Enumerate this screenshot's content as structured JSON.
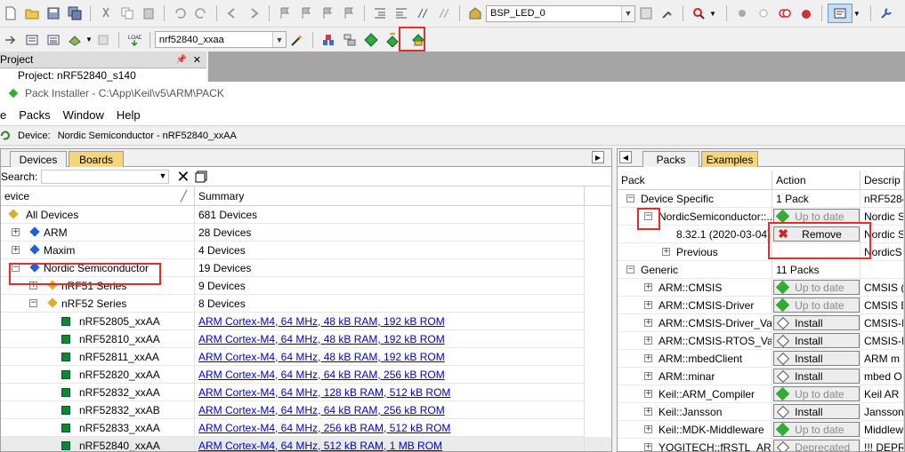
{
  "toolbar1": {
    "target_select": "BSP_LED_0"
  },
  "toolbar2": {
    "device_select": "nrf52840_xxaa"
  },
  "project_pane": {
    "title": "Project",
    "root": "Project: nRF52840_s140"
  },
  "pack_installer": {
    "title": "Pack Installer - C:\\App\\Keil\\v5\\ARM\\PACK",
    "menu": [
      "e",
      "Packs",
      "Window",
      "Help"
    ],
    "device_label": "Device:",
    "device_value": "Nordic Semiconductor - nRF52840_xxAA"
  },
  "left_panel": {
    "tabs": [
      "Devices",
      "Boards"
    ],
    "search_label": "Search:",
    "search_value": "",
    "columns": [
      "evice",
      "Summary"
    ],
    "rows": [
      {
        "name": "All Devices",
        "summary": "681 Devices",
        "link": false
      },
      {
        "name": "ARM",
        "summary": "28 Devices",
        "link": false
      },
      {
        "name": "Maxim",
        "summary": "4 Devices",
        "link": false
      },
      {
        "name": "Nordic Semiconductor",
        "summary": "19 Devices",
        "link": false
      },
      {
        "name": "nRF51 Series",
        "summary": "9 Devices",
        "link": false
      },
      {
        "name": "nRF52 Series",
        "summary": "8 Devices",
        "link": false
      },
      {
        "name": "nRF52805_xxAA",
        "summary": "ARM Cortex-M4, 64 MHz, 48 kB RAM, 192 kB ROM",
        "link": true
      },
      {
        "name": "nRF52810_xxAA",
        "summary": "ARM Cortex-M4, 64 MHz, 48 kB RAM, 192 kB ROM",
        "link": true
      },
      {
        "name": "nRF52811_xxAA",
        "summary": "ARM Cortex-M4, 64 MHz, 48 kB RAM, 192 kB ROM",
        "link": true
      },
      {
        "name": "nRF52820_xxAA",
        "summary": "ARM Cortex-M4, 64 MHz, 64 kB RAM, 256 kB ROM",
        "link": true
      },
      {
        "name": "nRF52832_xxAA",
        "summary": "ARM Cortex-M4, 64 MHz, 128 kB RAM, 512 kB ROM",
        "link": true
      },
      {
        "name": "nRF52832_xxAB",
        "summary": "ARM Cortex-M4, 64 MHz, 64 kB RAM, 256 kB ROM",
        "link": true
      },
      {
        "name": "nRF52833_xxAA",
        "summary": "ARM Cortex-M4, 64 MHz, 256 kB RAM, 512 kB ROM",
        "link": true
      },
      {
        "name": "nRF52840_xxAA",
        "summary": "ARM Cortex-M4, 64 MHz, 512 kB RAM, 1 MB ROM",
        "link": true
      }
    ]
  },
  "right_panel": {
    "tabs": [
      "Packs",
      "Examples"
    ],
    "columns": [
      "Pack",
      "Action",
      "Descrip"
    ],
    "rows": [
      {
        "pack": "Device Specific",
        "action": "1 Pack",
        "btn": "",
        "desc": "nRF5284"
      },
      {
        "pack": "NordicSemiconductor::...",
        "action": "Up to date",
        "btn": "uptodate",
        "desc": "Nordic S"
      },
      {
        "pack": "8.32.1 (2020-03-04)",
        "action": "Remove",
        "btn": "remove",
        "desc": "Nordic S"
      },
      {
        "pack": "Previous",
        "action": "",
        "btn": "",
        "desc": "NordicS"
      },
      {
        "pack": "Generic",
        "action": "11 Packs",
        "btn": "",
        "desc": ""
      },
      {
        "pack": "ARM::CMSIS",
        "action": "Up to date",
        "btn": "uptodate",
        "desc": "CMSIS ("
      },
      {
        "pack": "ARM::CMSIS-Driver",
        "action": "Up to date",
        "btn": "uptodate",
        "desc": "CMSIS D"
      },
      {
        "pack": "ARM::CMSIS-Driver_Va...",
        "action": "Install",
        "btn": "install",
        "desc": "CMSIS-I"
      },
      {
        "pack": "ARM::CMSIS-RTOS_Vali...",
        "action": "Install",
        "btn": "install",
        "desc": "CMSIS-I"
      },
      {
        "pack": "ARM::mbedClient",
        "action": "Install",
        "btn": "install",
        "desc": "ARM m"
      },
      {
        "pack": "ARM::minar",
        "action": "Install",
        "btn": "install",
        "desc": "mbed O"
      },
      {
        "pack": "Keil::ARM_Compiler",
        "action": "Up to date",
        "btn": "uptodate",
        "desc": "Keil AR"
      },
      {
        "pack": "Keil::Jansson",
        "action": "Install",
        "btn": "install",
        "desc": "Jansson"
      },
      {
        "pack": "Keil::MDK-Middleware",
        "action": "Up to date",
        "btn": "uptodate",
        "desc": "Middlew"
      },
      {
        "pack": "YOGITECH::fRSTL_AR...",
        "action": "Deprecated",
        "btn": "deprecated",
        "desc": "!!! DEPR"
      }
    ]
  },
  "colors": {
    "highlight_red": "#e52b2b",
    "tab_inactive": "#f5d57a",
    "link_blue": "#0000cc",
    "uptodate_green": "#2fae2f",
    "remove_red": "#d42020"
  }
}
